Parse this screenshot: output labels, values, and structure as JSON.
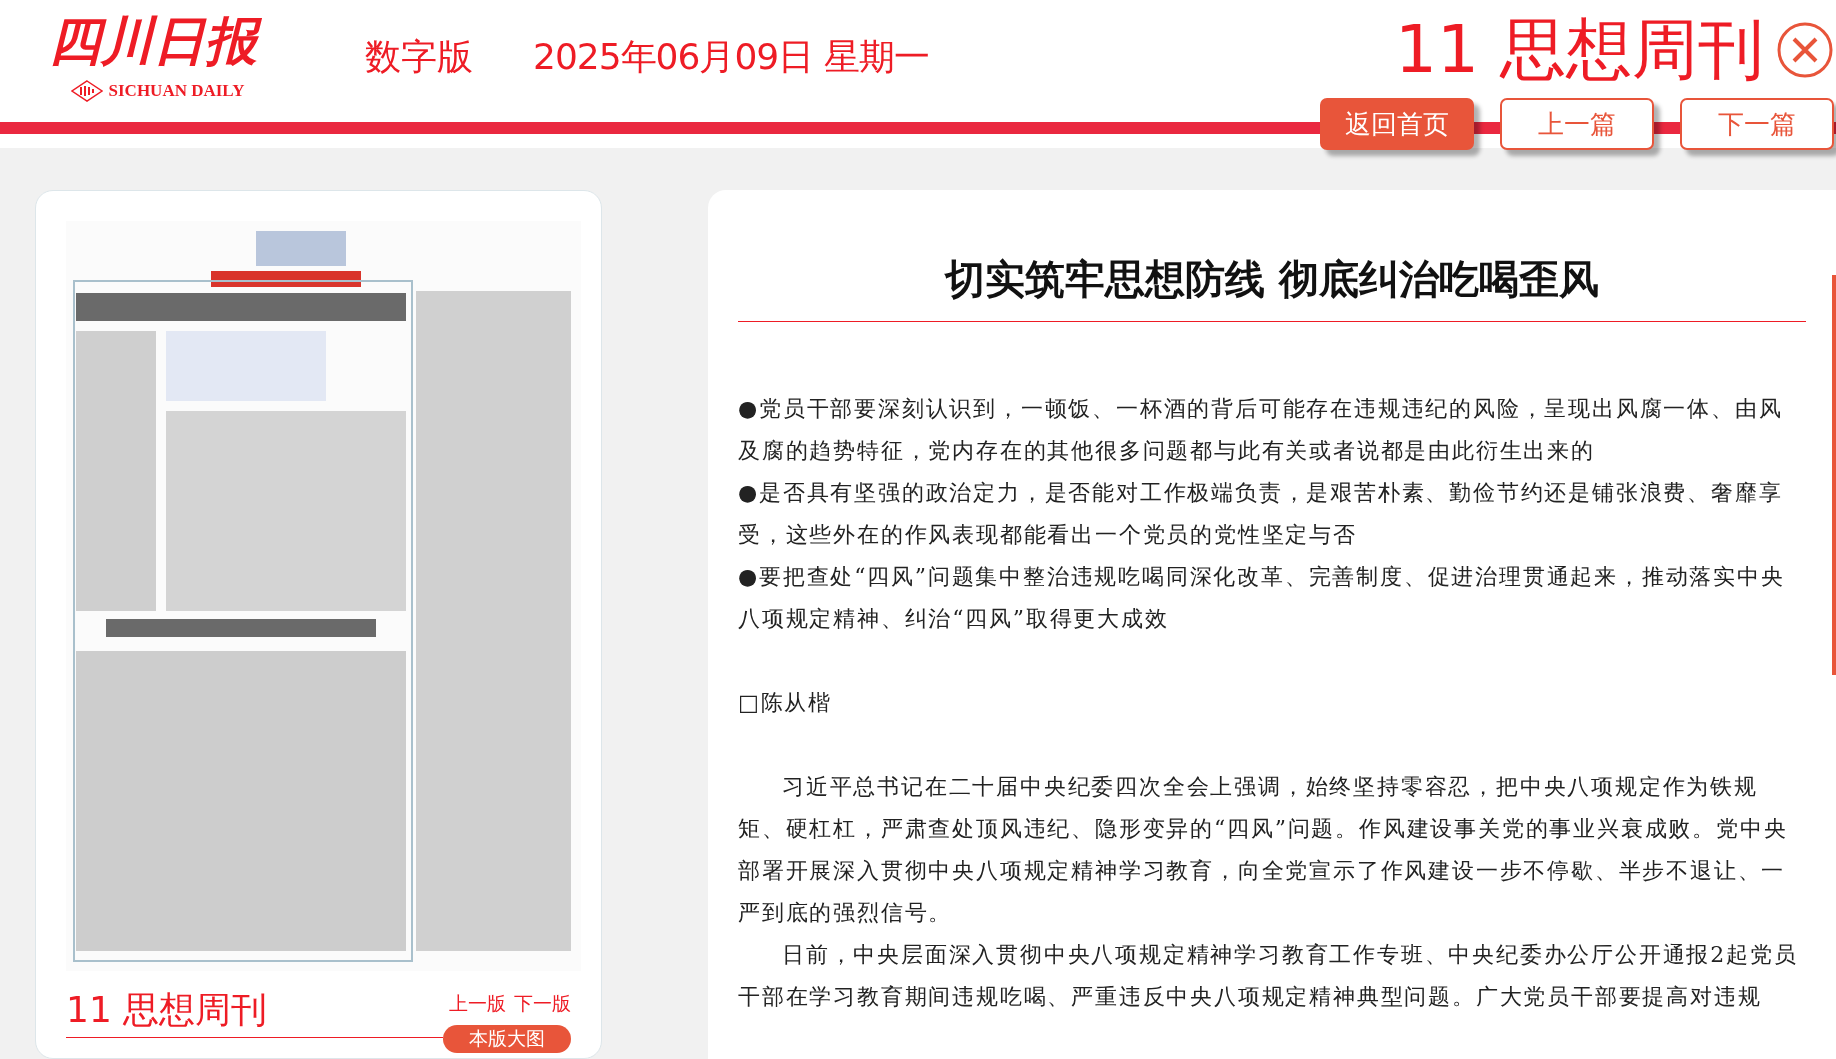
{
  "masthead": {
    "logo": "四川日报",
    "logo_en": "SICHUAN DAILY",
    "edition": "数字版",
    "date": "2025年06月09日 星期一"
  },
  "page_title": "11 思想周刊",
  "nav_buttons": [
    {
      "label": "返回首页",
      "selected": true
    },
    {
      "label": "上一篇",
      "selected": false
    },
    {
      "label": "下一篇",
      "selected": false
    }
  ],
  "page_panel": {
    "preview": {
      "kind": "picture"
    },
    "page_name": "11 思想周刊",
    "links": [
      "上一版",
      "下一版"
    ],
    "button": "本版大图"
  },
  "article": {
    "title": "切实筑牢思想防线 彻底纠治吃喝歪风",
    "paragraphs": [
      {
        "kind": "summary",
        "text": "●党员干部要深刻认识到，一顿饭、一杯酒的背后可能存在违规违纪的风险，呈现出风腐一体、由风及腐的趋势特征，党内存在的其他很多问题都与此有关或者说都是由此衍生出来的"
      },
      {
        "kind": "summary",
        "text": "●是否具有坚强的政治定力，是否能对工作极端负责，是艰苦朴素、勤俭节约还是铺张浪费、奢靡享受，这些外在的作风表现都能看出一个党员的党性坚定与否"
      },
      {
        "kind": "summary",
        "text": "●要把查处“四风”问题集中整治违规吃喝同深化改革、完善制度、促进治理贯通起来，推动落实中央八项规定精神、纠治“四风”取得更大成效"
      },
      {
        "kind": "byline",
        "text": "□陈从楷"
      },
      {
        "kind": "body",
        "text": "习近平总书记在二十届中央纪委四次全会上强调，始终坚持零容忍，把中央八项规定作为铁规矩、硬杠杠，严肃查处顶风违纪、隐形变异的“四风”问题。作风建设事关党的事业兴衰成败。党中央部署开展深入贯彻中央八项规定精神学习教育，向全党宣示了作风建设一步不停歇、半步不退让、一严到底的强烈信号。"
      },
      {
        "kind": "body",
        "text": "日前，中央层面深入贯彻中央八项规定精神学习教育工作专班、中央纪委办公厅公开通报2起党员干部在学习教育期间违规吃喝、严重违反中央八项规定精神典型问题。广大党员干部要提高对违规"
      }
    ]
  }
}
